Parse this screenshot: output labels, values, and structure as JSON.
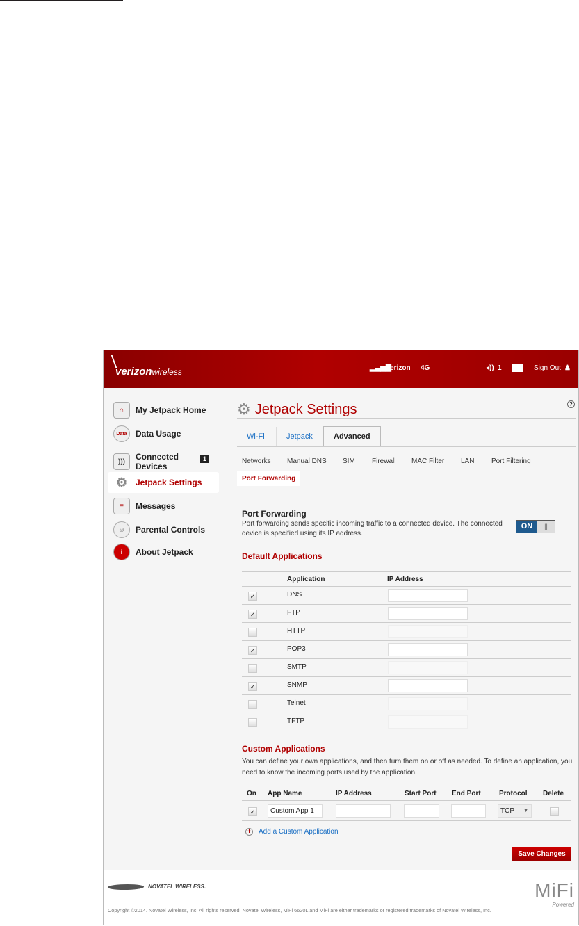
{
  "header": {
    "brand": "verizon",
    "brand_suffix": "wireless",
    "carrier": "Verizon",
    "network": "4G",
    "connected_count": "1",
    "sign_out": "Sign Out"
  },
  "sidebar": {
    "items": [
      {
        "label": "My Jetpack Home"
      },
      {
        "label": "Data Usage",
        "icon_text": "Data"
      },
      {
        "label": "Connected Devices",
        "badge": "1"
      },
      {
        "label": "Jetpack Settings"
      },
      {
        "label": "Messages"
      },
      {
        "label": "Parental Controls"
      },
      {
        "label": "About Jetpack"
      }
    ]
  },
  "main": {
    "title": "Jetpack Settings",
    "help": "?",
    "tabs": [
      "Wi-Fi",
      "Jetpack",
      "Advanced"
    ],
    "subtabs": [
      "Networks",
      "Manual DNS",
      "SIM",
      "Firewall",
      "MAC Filter",
      "LAN",
      "Port Filtering",
      "Port Forwarding"
    ],
    "pf_title": "Port Forwarding",
    "pf_desc": "Port forwarding sends specific incoming traffic to a connected device. The connected device is specified using its IP address.",
    "toggle_on": "ON",
    "toggle_off": "||",
    "default_title": "Default Applications",
    "default_headers": [
      "Application",
      "IP Address"
    ],
    "default_apps": [
      {
        "name": "DNS",
        "checked": true,
        "ip": ""
      },
      {
        "name": "FTP",
        "checked": true,
        "ip": ""
      },
      {
        "name": "HTTP",
        "checked": false,
        "ip": ""
      },
      {
        "name": "POP3",
        "checked": true,
        "ip": ""
      },
      {
        "name": "SMTP",
        "checked": false,
        "ip": ""
      },
      {
        "name": "SNMP",
        "checked": true,
        "ip": ""
      },
      {
        "name": "Telnet",
        "checked": false,
        "ip": ""
      },
      {
        "name": "TFTP",
        "checked": false,
        "ip": ""
      }
    ],
    "custom_title": "Custom Applications",
    "custom_desc": "You can define your own applications, and then turn them on or off as needed. To define an application, you need to know the incoming ports used by the application.",
    "custom_headers": [
      "On",
      "App Name",
      "IP Address",
      "Start Port",
      "End Port",
      "Protocol",
      "Delete"
    ],
    "custom_apps": [
      {
        "on": true,
        "name": "Custom App 1",
        "ip": "",
        "start": "",
        "end": "",
        "protocol": "TCP"
      }
    ],
    "add_link": "Add a Custom Application",
    "save": "Save Changes"
  },
  "footer": {
    "novatel": "NOVATEL WIRELESS.",
    "mifi": "MiFi",
    "powered": "Powered",
    "copyright": "Copyright ©2014. Novatel Wireless, Inc. All rights reserved. Novatel Wireless, MiFi 6620L and MiFi are either trademarks or registered trademarks of Novatel Wireless, Inc."
  }
}
